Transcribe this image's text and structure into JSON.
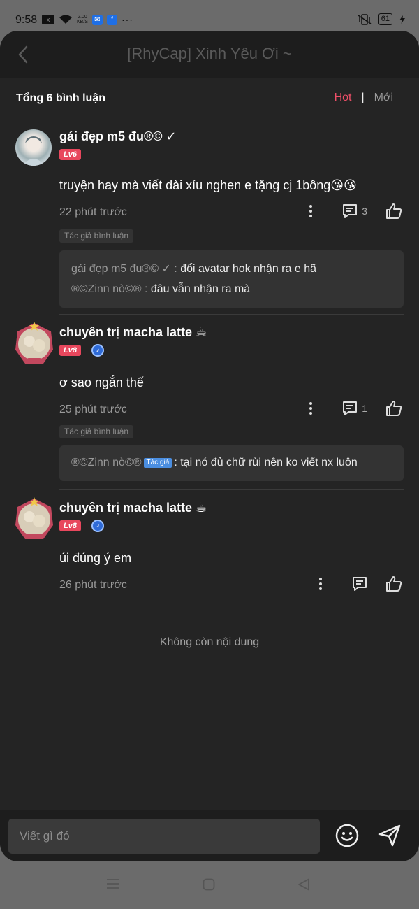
{
  "status_bar": {
    "time": "9:58",
    "speed": "2.00",
    "speed_unit": "KB/S",
    "battery": "61",
    "fb": "f",
    "more": "···",
    "sim": "x"
  },
  "header": {
    "title": "[RhyCap] Xinh Yêu Ơi ~"
  },
  "summary": {
    "total": "Tổng 6 bình luận",
    "sort_hot": "Hot",
    "sort_separator": "|",
    "sort_new": "Mới"
  },
  "comments": [
    {
      "username": "gái đẹp m5 đu®© ✓",
      "level": "Lv6",
      "text": "truyện hay mà viết dài xíu nghen e tặng cj 1bông😘😘",
      "time": "22 phút trước",
      "reply_count": "3",
      "author_tag": "Tác giả bình luận",
      "replies": [
        {
          "name": "gái đẹp m5 đu®© ✓ :",
          "text": "đổi avatar hok nhận ra e hã"
        },
        {
          "name": "®©Zinn nò©® :",
          "text": "đâu vẫn nhận ra mà"
        }
      ]
    },
    {
      "username": "chuyên trị macha latte ☕",
      "level": "Lv8",
      "text": "ơ sao ngắn thế",
      "time": "25 phút trước",
      "reply_count": "1",
      "author_tag": "Tác giả bình luận",
      "replies": [
        {
          "name": "®©Zinn nò©®",
          "badge": "Tác giả",
          "text": ": tại nó đủ chữ rùi nên ko viết nx luôn"
        }
      ]
    },
    {
      "username": "chuyên trị macha latte ☕",
      "level": "Lv8",
      "text": "úi đúng ý em",
      "time": "26 phút trước"
    }
  ],
  "end_note": "Không còn nội dung",
  "composer": {
    "placeholder": "Viết gì đó"
  },
  "colors": {
    "accent": "#ef4f68",
    "level_badge": "#e8475d",
    "background": "#242424",
    "author_badge": "#4b8ee0"
  },
  "icons": [
    "back-arrow-icon",
    "more-vertical-icon",
    "reply-icon",
    "like-icon",
    "emoji-icon",
    "send-icon",
    "menu-icon",
    "home-icon",
    "back-triangle-icon"
  ]
}
